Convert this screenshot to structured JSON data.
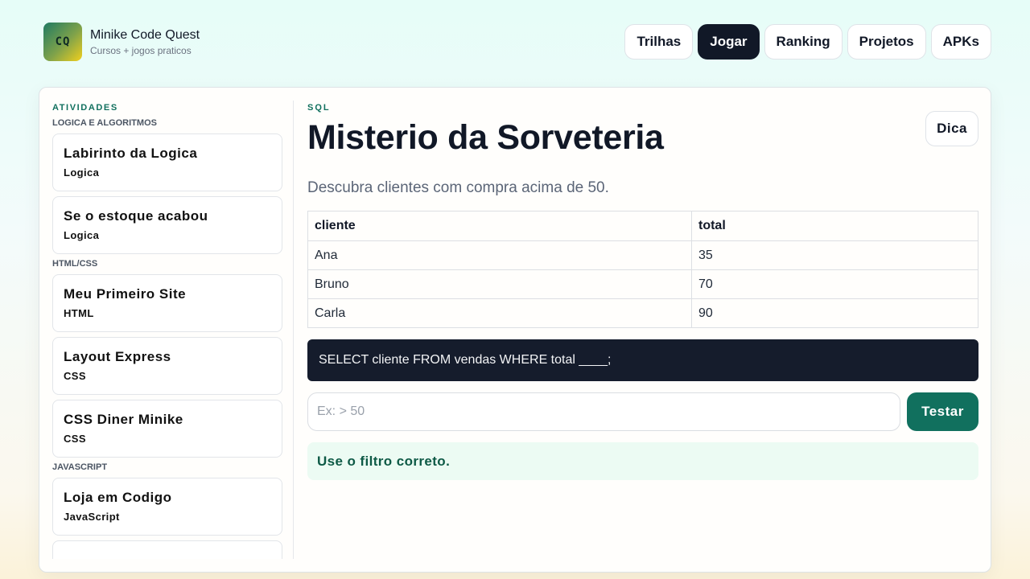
{
  "brand": {
    "logo_text": "CQ",
    "title": "Minike Code Quest",
    "subtitle": "Cursos + jogos praticos"
  },
  "nav": [
    {
      "label": "Trilhas",
      "active": false
    },
    {
      "label": "Jogar",
      "active": true
    },
    {
      "label": "Ranking",
      "active": false
    },
    {
      "label": "Projetos",
      "active": false
    },
    {
      "label": "APKs",
      "active": false
    }
  ],
  "sidebar": {
    "heading": "ATIVIDADES",
    "groups": [
      {
        "label": "LOGICA E ALGORITMOS",
        "items": [
          {
            "title": "Labirinto da Logica",
            "tag": "Logica"
          },
          {
            "title": "Se o estoque acabou",
            "tag": "Logica"
          }
        ]
      },
      {
        "label": "HTML/CSS",
        "items": [
          {
            "title": "Meu Primeiro Site",
            "tag": "HTML"
          },
          {
            "title": "Layout Express",
            "tag": "CSS"
          },
          {
            "title": "CSS Diner Minike",
            "tag": "CSS"
          }
        ]
      },
      {
        "label": "JAVASCRIPT",
        "items": [
          {
            "title": "Loja em Codigo",
            "tag": "JavaScript"
          }
        ]
      }
    ]
  },
  "main": {
    "eyebrow": "SQL",
    "title": "Misterio da Sorveteria",
    "hint_label": "Dica",
    "description": "Descubra clientes com compra acima de 50.",
    "table": {
      "columns": [
        "cliente",
        "total"
      ],
      "rows": [
        [
          "Ana",
          "35"
        ],
        [
          "Bruno",
          "70"
        ],
        [
          "Carla",
          "90"
        ]
      ]
    },
    "code": "SELECT cliente FROM vendas WHERE total ____;",
    "answer_placeholder": "Ex: > 50",
    "answer_value": "",
    "test_label": "Testar",
    "feedback": "Use o filtro correto."
  },
  "colors": {
    "accent": "#11705e",
    "dark": "#111827",
    "code_bg": "#151c2c",
    "feedback_bg": "#ecfbf3"
  }
}
